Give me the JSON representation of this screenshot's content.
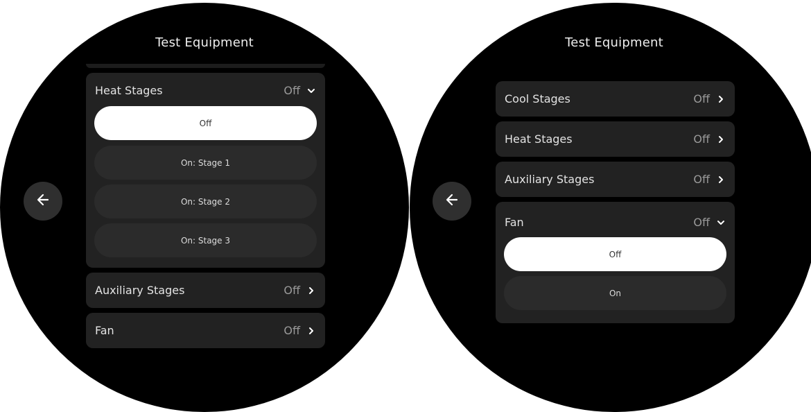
{
  "left": {
    "title": "Test Equipment",
    "heat": {
      "label": "Heat Stages",
      "value": "Off",
      "options": [
        "Off",
        "On: Stage 1",
        "On: Stage 2",
        "On: Stage 3"
      ],
      "selected": "Off"
    },
    "rows": [
      {
        "label": "Auxiliary Stages",
        "value": "Off"
      },
      {
        "label": "Fan",
        "value": "Off"
      }
    ]
  },
  "right": {
    "title": "Test Equipment",
    "rows": [
      {
        "label": "Cool Stages",
        "value": "Off"
      },
      {
        "label": "Heat Stages",
        "value": "Off"
      },
      {
        "label": "Auxiliary Stages",
        "value": "Off"
      }
    ],
    "fan": {
      "label": "Fan",
      "value": "Off",
      "options": [
        "Off",
        "On"
      ],
      "selected": "Off"
    }
  },
  "icons": {
    "back": "arrow-left-icon",
    "collapsed": "chevron-right-icon",
    "expanded": "chevron-down-icon"
  },
  "colors": {
    "screen_bg": "#000000",
    "card_bg": "#222222",
    "option_bg": "#2b2b2b",
    "selected_bg": "#ffffff"
  }
}
